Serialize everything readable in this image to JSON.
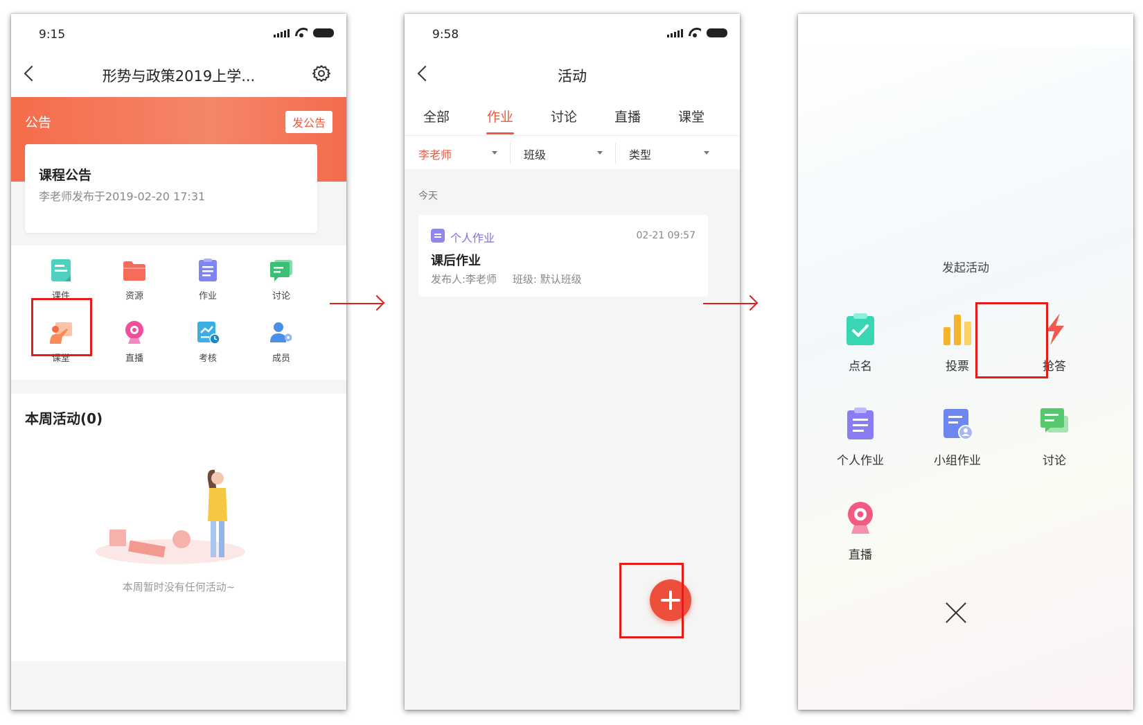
{
  "screen1": {
    "time": "9:15",
    "title": "形势与政策2019上学...",
    "banner_label": "公告",
    "announce_button": "发公告",
    "notice": {
      "title": "课程公告",
      "subtitle": "李老师发布于2019-02-20 17:31"
    },
    "grid": [
      {
        "label": "课件",
        "icon": "courseware-icon",
        "color": "#4fd1c1"
      },
      {
        "label": "资源",
        "icon": "folder-icon",
        "color": "#f76b5b"
      },
      {
        "label": "作业",
        "icon": "homework-icon",
        "color": "#7d86ef"
      },
      {
        "label": "讨论",
        "icon": "discussion-icon",
        "color": "#3dbe76"
      },
      {
        "label": "课堂",
        "icon": "classroom-icon",
        "color": "#f78c5a"
      },
      {
        "label": "直播",
        "icon": "live-icon",
        "color": "#ef4f9c"
      },
      {
        "label": "考核",
        "icon": "assessment-icon",
        "color": "#3aaee6"
      },
      {
        "label": "成员",
        "icon": "members-icon",
        "color": "#4a8fe8"
      }
    ],
    "week_title": "本周活动(0)",
    "empty_text": "本周暂时没有任何活动~"
  },
  "screen2": {
    "time": "9:58",
    "title": "活动",
    "tabs": [
      "全部",
      "作业",
      "讨论",
      "直播",
      "课堂"
    ],
    "active_tab": 1,
    "filters": [
      "李老师",
      "班级",
      "类型"
    ],
    "section": "今天",
    "card": {
      "type": "个人作业",
      "time": "02-21 09:57",
      "title": "课后作业",
      "publisher": "发布人:李老师",
      "class": "班级: 默认班级"
    }
  },
  "screen3": {
    "title": "发起活动",
    "items": [
      {
        "label": "点名",
        "icon": "roll-call-icon",
        "color": "#3ad6b4"
      },
      {
        "label": "投票",
        "icon": "vote-icon",
        "color": "#f9b22a"
      },
      {
        "label": "抢答",
        "icon": "lightning-icon",
        "color": "#f2584b"
      },
      {
        "label": "个人作业",
        "icon": "personal-homework-icon",
        "color": "#8a7cf2"
      },
      {
        "label": "小组作业",
        "icon": "group-homework-icon",
        "color": "#6d86f1"
      },
      {
        "label": "讨论",
        "icon": "discussion-icon",
        "color": "#55c86d"
      },
      {
        "label": "直播",
        "icon": "live-icon",
        "color": "#f25a82"
      }
    ]
  }
}
